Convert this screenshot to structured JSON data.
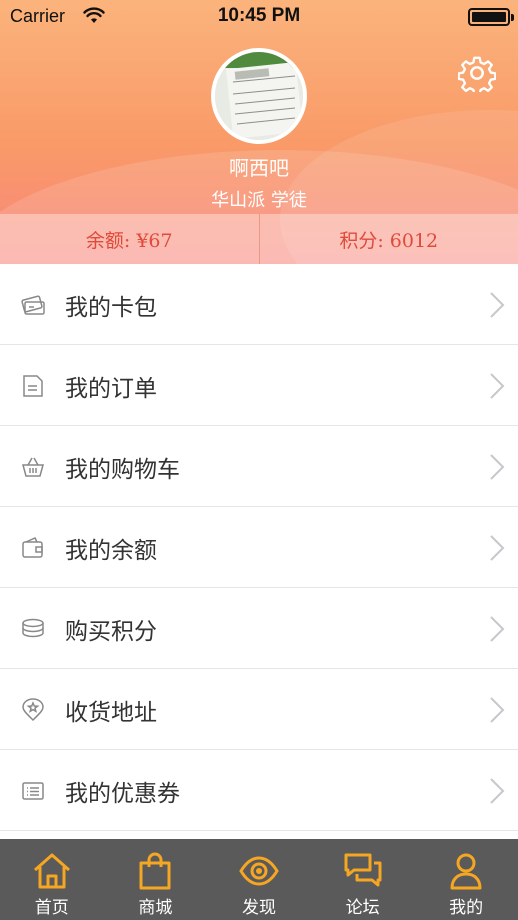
{
  "status_bar": {
    "carrier": "Carrier",
    "time": "10:45 PM"
  },
  "profile": {
    "username": "啊西吧",
    "rank": "华山派 学徒",
    "balance": "余额: ¥67",
    "points": "积分: 6012"
  },
  "menu": [
    {
      "label": "我的卡包",
      "icon": "card-wallet-icon"
    },
    {
      "label": "我的订单",
      "icon": "order-document-icon"
    },
    {
      "label": "我的购物车",
      "icon": "shopping-basket-icon"
    },
    {
      "label": "我的余额",
      "icon": "wallet-icon"
    },
    {
      "label": "购买积分",
      "icon": "coin-stack-icon"
    },
    {
      "label": "收货地址",
      "icon": "location-pin-icon"
    },
    {
      "label": "我的优惠券",
      "icon": "coupon-icon"
    }
  ],
  "tabbar": [
    {
      "label": "首页",
      "icon": "home-icon"
    },
    {
      "label": "商城",
      "icon": "shopping-bag-icon"
    },
    {
      "label": "发现",
      "icon": "eye-icon"
    },
    {
      "label": "论坛",
      "icon": "chat-bubbles-icon"
    },
    {
      "label": "我的",
      "icon": "user-icon"
    }
  ],
  "colors": {
    "accent": "#f5a623",
    "header": "#f99a68",
    "stat_text": "#e04a3a",
    "tabbar": "#5a5a5a"
  }
}
